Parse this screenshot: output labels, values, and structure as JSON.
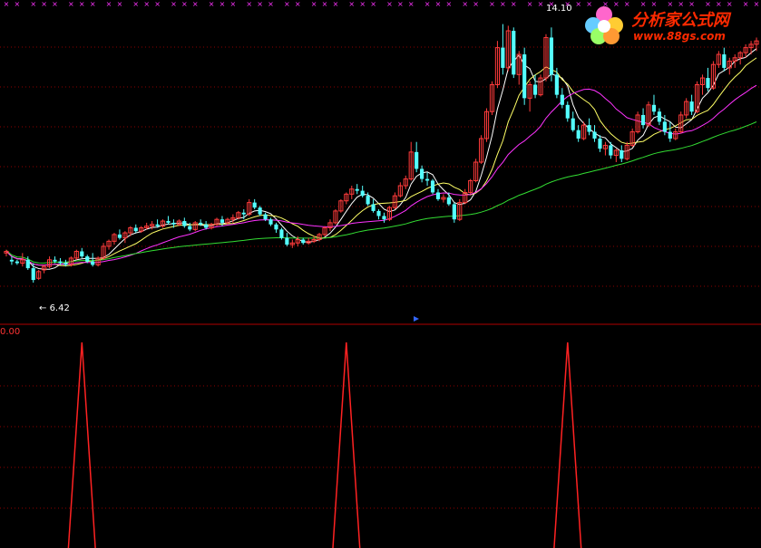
{
  "watermark": {
    "text": "分析家公式网",
    "url": "www.88gs.com"
  },
  "colors": {
    "background": "#000000",
    "up_candle": "#ff3b3b",
    "down_candle": "#54ffff",
    "ma_white": "#ffffff",
    "ma_yellow": "#ffff66",
    "ma_magenta": "#ff33ff",
    "ma_green": "#33dd33",
    "signal": "#ff2222",
    "marker": "#ff33ff",
    "grid": "#8b0000"
  },
  "chart_data": [
    {
      "type": "candlestick",
      "title": "",
      "price_labels": {
        "low": "6.42",
        "high": "14.10"
      },
      "ylim": [
        5.4,
        14.6
      ],
      "x_count": 140,
      "candles_ohlc": [
        [
          7.3,
          7.4,
          7.2,
          7.35
        ],
        [
          7.1,
          7.2,
          6.95,
          7.05
        ],
        [
          7.05,
          7.1,
          6.95,
          7.0
        ],
        [
          7.0,
          7.3,
          6.9,
          7.1
        ],
        [
          7.1,
          7.2,
          6.8,
          6.85
        ],
        [
          6.85,
          7.0,
          6.42,
          6.5
        ],
        [
          6.55,
          6.8,
          6.5,
          6.75
        ],
        [
          6.8,
          6.95,
          6.7,
          6.9
        ],
        [
          6.9,
          7.2,
          6.85,
          7.1
        ],
        [
          7.1,
          7.2,
          7.0,
          7.05
        ],
        [
          7.05,
          7.15,
          6.95,
          7.0
        ],
        [
          7.0,
          7.1,
          6.9,
          6.95
        ],
        [
          6.95,
          7.2,
          6.9,
          7.15
        ],
        [
          7.15,
          7.4,
          7.1,
          7.35
        ],
        [
          7.35,
          7.45,
          7.15,
          7.2
        ],
        [
          7.2,
          7.25,
          7.0,
          7.05
        ],
        [
          7.05,
          7.3,
          6.9,
          6.95
        ],
        [
          6.95,
          7.2,
          6.9,
          7.15
        ],
        [
          7.15,
          7.6,
          7.1,
          7.5
        ],
        [
          7.5,
          7.7,
          7.4,
          7.65
        ],
        [
          7.65,
          7.9,
          7.55,
          7.85
        ],
        [
          7.85,
          8.0,
          7.7,
          7.75
        ],
        [
          7.75,
          7.95,
          7.6,
          7.9
        ],
        [
          7.9,
          8.1,
          7.8,
          8.05
        ],
        [
          8.05,
          8.15,
          7.9,
          7.95
        ],
        [
          7.95,
          8.1,
          7.9,
          8.05
        ],
        [
          8.05,
          8.2,
          8.0,
          8.1
        ],
        [
          8.1,
          8.25,
          8.0,
          8.15
        ],
        [
          8.15,
          8.3,
          8.05,
          8.1
        ],
        [
          8.1,
          8.3,
          8.05,
          8.25
        ],
        [
          8.25,
          8.4,
          8.15,
          8.2
        ],
        [
          8.2,
          8.3,
          8.05,
          8.15
        ],
        [
          8.15,
          8.3,
          8.1,
          8.25
        ],
        [
          8.25,
          8.35,
          8.05,
          8.1
        ],
        [
          8.1,
          8.2,
          7.95,
          8.0
        ],
        [
          8.0,
          8.25,
          7.95,
          8.2
        ],
        [
          8.2,
          8.3,
          8.1,
          8.15
        ],
        [
          8.15,
          8.25,
          8.0,
          8.05
        ],
        [
          8.05,
          8.2,
          8.0,
          8.15
        ],
        [
          8.15,
          8.35,
          8.1,
          8.3
        ],
        [
          8.3,
          8.4,
          8.1,
          8.2
        ],
        [
          8.2,
          8.35,
          8.15,
          8.3
        ],
        [
          8.3,
          8.45,
          8.2,
          8.35
        ],
        [
          8.35,
          8.55,
          8.3,
          8.5
        ],
        [
          8.5,
          8.6,
          8.3,
          8.45
        ],
        [
          8.45,
          8.9,
          8.4,
          8.8
        ],
        [
          8.8,
          8.9,
          8.6,
          8.65
        ],
        [
          8.65,
          8.7,
          8.4,
          8.45
        ],
        [
          8.45,
          8.5,
          8.25,
          8.3
        ],
        [
          8.3,
          8.35,
          8.1,
          8.15
        ],
        [
          8.15,
          8.2,
          7.9,
          8.0
        ],
        [
          8.0,
          8.05,
          7.7,
          7.75
        ],
        [
          7.75,
          7.9,
          7.5,
          7.55
        ],
        [
          7.55,
          7.7,
          7.45,
          7.6
        ],
        [
          7.6,
          7.8,
          7.5,
          7.7
        ],
        [
          7.7,
          7.75,
          7.55,
          7.6
        ],
        [
          7.6,
          7.75,
          7.55,
          7.65
        ],
        [
          7.65,
          7.8,
          7.6,
          7.7
        ],
        [
          7.7,
          7.9,
          7.65,
          7.85
        ],
        [
          7.85,
          8.1,
          7.8,
          8.05
        ],
        [
          8.05,
          8.3,
          7.95,
          8.2
        ],
        [
          8.2,
          8.6,
          8.15,
          8.55
        ],
        [
          8.55,
          8.9,
          8.5,
          8.85
        ],
        [
          8.85,
          9.1,
          8.75,
          9.05
        ],
        [
          9.05,
          9.3,
          8.9,
          9.2
        ],
        [
          9.2,
          9.35,
          9.05,
          9.15
        ],
        [
          9.15,
          9.3,
          8.95,
          9.0
        ],
        [
          9.0,
          9.1,
          8.7,
          8.75
        ],
        [
          8.75,
          8.9,
          8.5,
          8.55
        ],
        [
          8.55,
          8.6,
          8.3,
          8.4
        ],
        [
          8.4,
          8.5,
          8.2,
          8.3
        ],
        [
          8.3,
          8.7,
          8.25,
          8.65
        ],
        [
          8.65,
          9.1,
          8.6,
          9.0
        ],
        [
          9.0,
          9.4,
          8.95,
          9.3
        ],
        [
          9.3,
          9.6,
          9.2,
          9.5
        ],
        [
          9.5,
          10.6,
          9.45,
          10.3
        ],
        [
          10.3,
          10.6,
          9.7,
          9.8
        ],
        [
          9.8,
          9.9,
          9.4,
          9.5
        ],
        [
          9.5,
          9.7,
          9.3,
          9.45
        ],
        [
          9.45,
          9.5,
          9.05,
          9.1
        ],
        [
          9.1,
          9.2,
          8.85,
          8.9
        ],
        [
          8.9,
          9.05,
          8.8,
          8.95
        ],
        [
          8.95,
          9.1,
          8.7,
          8.75
        ],
        [
          8.75,
          8.8,
          8.2,
          8.3
        ],
        [
          8.3,
          8.9,
          8.25,
          8.8
        ],
        [
          8.8,
          9.2,
          8.75,
          9.1
        ],
        [
          9.1,
          9.5,
          9.05,
          9.45
        ],
        [
          9.45,
          10.1,
          9.4,
          10.0
        ],
        [
          10.0,
          10.8,
          9.95,
          10.7
        ],
        [
          10.7,
          11.6,
          10.6,
          11.5
        ],
        [
          11.5,
          12.4,
          11.4,
          12.3
        ],
        [
          12.3,
          13.6,
          12.2,
          13.4
        ],
        [
          13.4,
          14.1,
          12.6,
          12.8
        ],
        [
          12.8,
          14.05,
          12.7,
          13.9
        ],
        [
          13.9,
          14.0,
          12.5,
          12.6
        ],
        [
          12.6,
          13.3,
          12.3,
          13.2
        ],
        [
          13.2,
          13.4,
          11.7,
          11.9
        ],
        [
          11.9,
          12.4,
          11.5,
          12.3
        ],
        [
          12.3,
          12.6,
          11.9,
          12.0
        ],
        [
          12.0,
          12.6,
          11.95,
          12.5
        ],
        [
          12.5,
          13.8,
          12.4,
          13.7
        ],
        [
          13.7,
          14.0,
          12.4,
          12.6
        ],
        [
          12.6,
          12.8,
          11.9,
          12.0
        ],
        [
          12.0,
          12.2,
          11.6,
          11.7
        ],
        [
          11.7,
          11.8,
          11.2,
          11.3
        ],
        [
          11.3,
          11.5,
          10.9,
          10.95
        ],
        [
          10.95,
          11.1,
          10.6,
          10.7
        ],
        [
          10.7,
          11.2,
          10.65,
          11.1
        ],
        [
          11.1,
          11.3,
          10.8,
          10.9
        ],
        [
          10.9,
          11.1,
          10.6,
          10.7
        ],
        [
          10.7,
          10.8,
          10.3,
          10.4
        ],
        [
          10.4,
          10.6,
          10.2,
          10.5
        ],
        [
          10.5,
          10.6,
          10.1,
          10.2
        ],
        [
          10.2,
          10.4,
          10.0,
          10.35
        ],
        [
          10.35,
          10.5,
          10.0,
          10.1
        ],
        [
          10.1,
          10.6,
          10.05,
          10.5
        ],
        [
          10.5,
          11.0,
          10.45,
          10.9
        ],
        [
          10.9,
          11.5,
          10.85,
          11.4
        ],
        [
          11.4,
          11.6,
          11.0,
          11.1
        ],
        [
          11.1,
          11.8,
          11.05,
          11.7
        ],
        [
          11.7,
          12.0,
          11.4,
          11.5
        ],
        [
          11.5,
          11.6,
          11.1,
          11.2
        ],
        [
          11.2,
          11.4,
          10.8,
          10.9
        ],
        [
          10.9,
          11.2,
          10.6,
          10.7
        ],
        [
          10.7,
          11.0,
          10.65,
          10.9
        ],
        [
          10.9,
          11.5,
          10.85,
          11.4
        ],
        [
          11.4,
          11.9,
          11.3,
          11.8
        ],
        [
          11.8,
          12.0,
          11.4,
          11.5
        ],
        [
          11.5,
          12.4,
          11.45,
          12.3
        ],
        [
          12.3,
          12.6,
          12.0,
          12.5
        ],
        [
          12.5,
          12.8,
          12.1,
          12.2
        ],
        [
          12.2,
          13.0,
          12.15,
          12.9
        ],
        [
          12.9,
          13.3,
          12.8,
          13.2
        ],
        [
          13.2,
          13.4,
          12.7,
          12.8
        ],
        [
          12.8,
          13.1,
          12.6,
          13.0
        ],
        [
          13.0,
          13.2,
          12.8,
          13.1
        ],
        [
          13.1,
          13.3,
          12.9,
          13.25
        ],
        [
          13.25,
          13.5,
          13.1,
          13.4
        ],
        [
          13.4,
          13.6,
          13.2,
          13.5
        ],
        [
          13.5,
          13.7,
          13.3,
          13.6
        ]
      ],
      "moving_averages": [
        {
          "period": 5,
          "color": "#ffffff"
        },
        {
          "period": 10,
          "color": "#ffff66"
        },
        {
          "period": 20,
          "color": "#ff33ff"
        },
        {
          "period": 60,
          "color": "#33dd33"
        }
      ],
      "top_markers_count": 60
    },
    {
      "type": "line",
      "title": "",
      "axis_label": "0.00",
      "ylim": [
        0,
        1
      ],
      "signal_spikes_at_index": [
        14,
        63,
        104
      ],
      "signal_value": 1
    }
  ]
}
